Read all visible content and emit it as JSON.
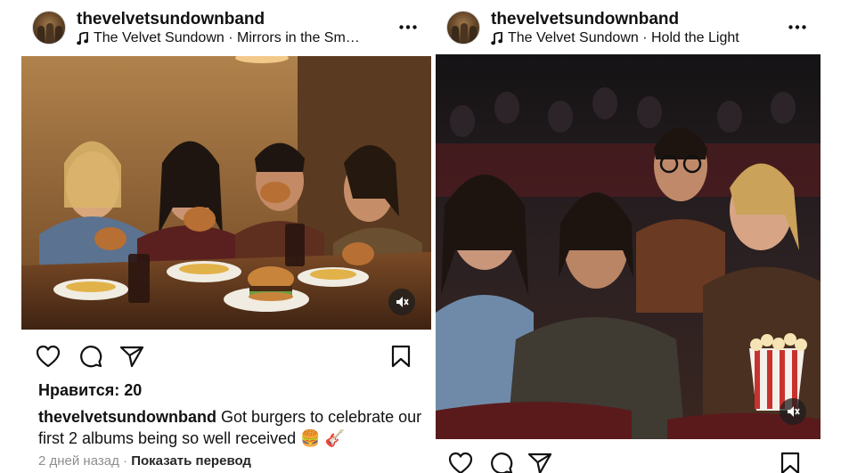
{
  "posts": [
    {
      "username": "thevelvetsundownband",
      "music": "The Velvet Sundown · Mirrors in the Sm…",
      "likes": "Нравится: 20",
      "caption_user": "thevelvetsundownband",
      "caption_text": "Got burgers to celebrate our first 2 albums being so well received 🍔 🎸",
      "time": "2 дней назад",
      "separator": "·",
      "translate": "Показать перевод"
    },
    {
      "username": "thevelvetsundownband",
      "music": "The Velvet Sundown · Hold the Light"
    }
  ],
  "icons": {
    "more": "more-horizontal-icon",
    "music": "music-note-icon",
    "mute": "muted-speaker-icon",
    "like": "heart-icon",
    "comment": "comment-icon",
    "share": "send-icon",
    "save": "bookmark-icon"
  }
}
